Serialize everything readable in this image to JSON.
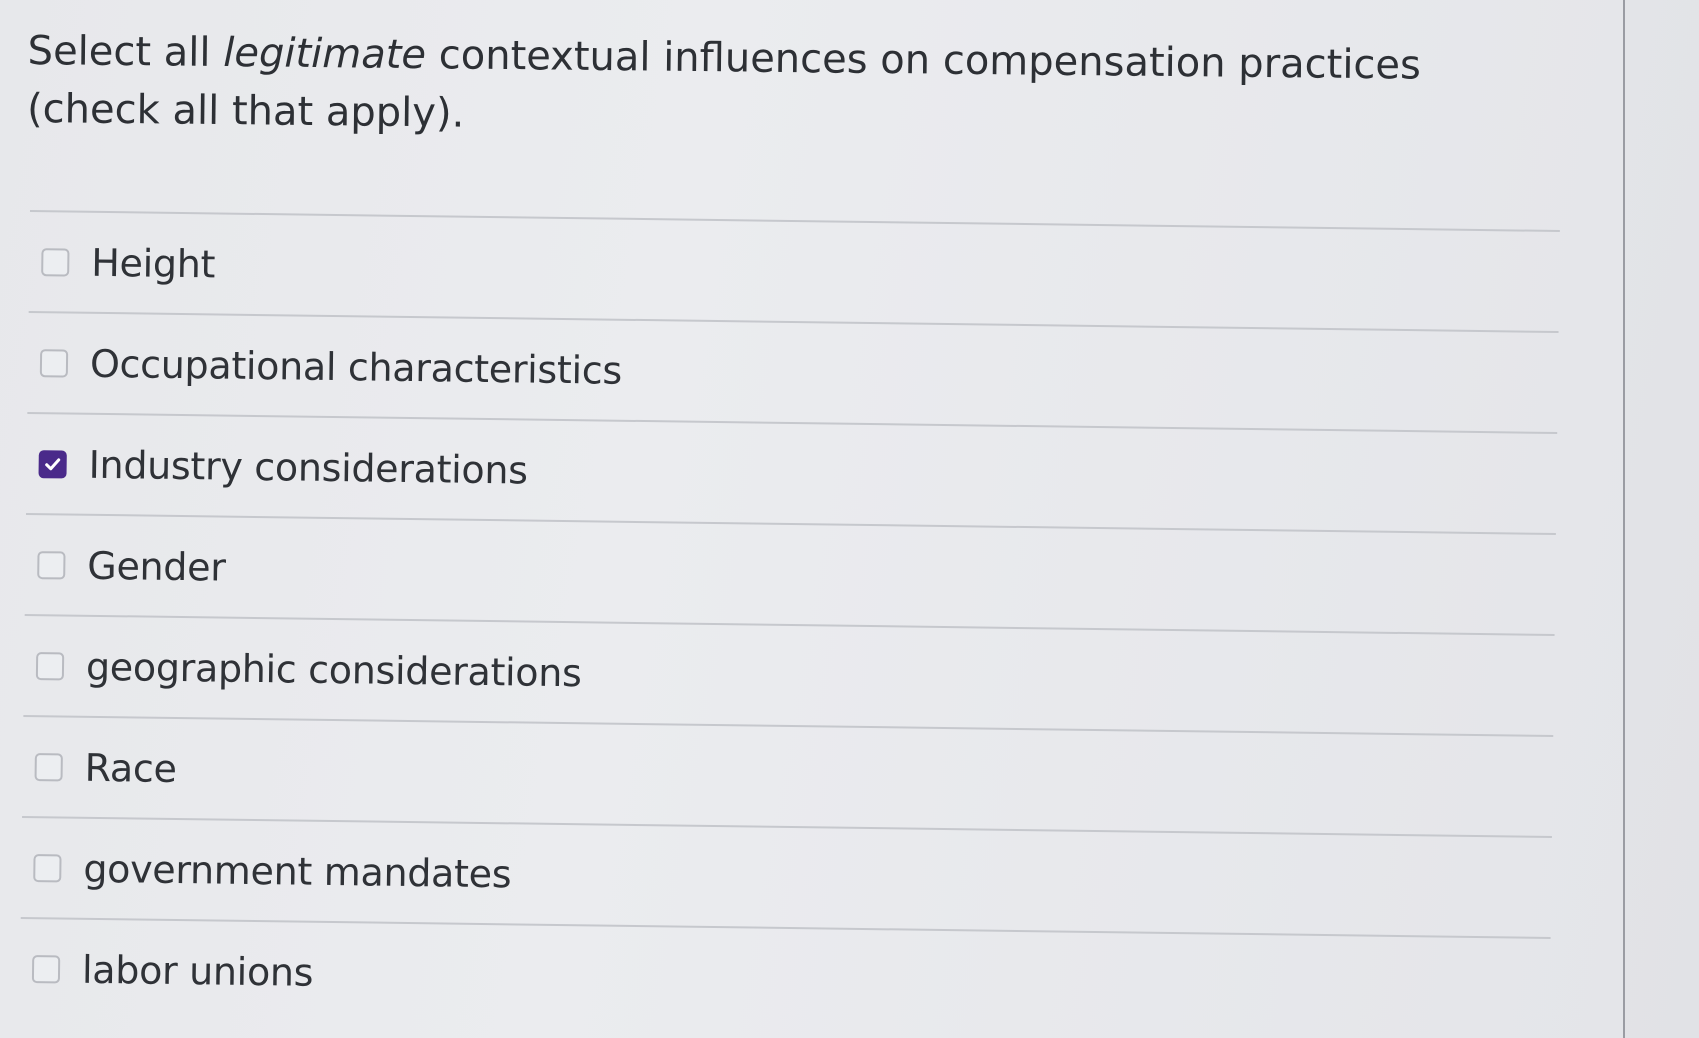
{
  "question": {
    "text_before": "Select all ",
    "emphasis": "legitimate",
    "text_after": " contextual influences on compensation practices (check all that apply)."
  },
  "options": [
    {
      "label": "Height",
      "checked": false
    },
    {
      "label": "Occupational characteristics",
      "checked": false
    },
    {
      "label": "Industry considerations",
      "checked": true
    },
    {
      "label": "Gender",
      "checked": false
    },
    {
      "label": "geographic considerations",
      "checked": false
    },
    {
      "label": "Race",
      "checked": false
    },
    {
      "label": "government mandates",
      "checked": false
    },
    {
      "label": "labor unions",
      "checked": false
    }
  ],
  "colors": {
    "checked_fill": "#4a2a8a",
    "text": "#2f3237"
  }
}
